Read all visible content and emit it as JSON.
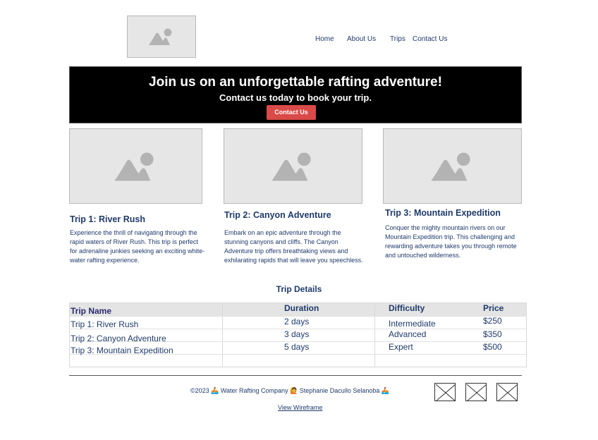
{
  "header": {
    "logo_icon": "image-placeholder-icon",
    "nav": [
      {
        "label": "Home"
      },
      {
        "label": "About Us"
      },
      {
        "label": "Trips"
      },
      {
        "label": "Contact Us"
      }
    ]
  },
  "hero": {
    "title": "Join us on an unforgettable rafting adventure!",
    "subtitle": "Contact us today to book your trip.",
    "button": "Contact Us",
    "button_color": "#d94a48"
  },
  "trips": [
    {
      "title": "Trip 1: River Rush",
      "desc": "Experience the thrill of navigating through the rapid waters of River Rush. This trip is perfect for adrenaline junkies seeking an exciting white-water rafting experience."
    },
    {
      "title": "Trip 2: Canyon Adventure",
      "desc": "Embark on an epic adventure through the stunning canyons and cliffs. The Canyon Adventure trip offers breathtaking views and exhilarating rapids that will leave you speechless."
    },
    {
      "title": "Trip 3: Mountain Expedition",
      "desc": "Conquer the mighty mountain rivers on our Mountain Expedition trip. This challenging and rewarding adventure takes you through remote and untouched wilderness."
    }
  ],
  "details": {
    "title": "Trip Details",
    "headers": [
      "Trip Name",
      "Duration",
      "Difficulty",
      "Price"
    ],
    "rows": [
      [
        "Trip 1: River Rush",
        "2 days",
        "Intermediate",
        "$250"
      ],
      [
        "Trip 2: Canyon Adventure",
        "3 days",
        "Advanced",
        "$350"
      ],
      [
        "Trip 3: Mountain Expedition",
        "5 days",
        "Expert",
        "$500"
      ]
    ]
  },
  "footer": {
    "text": "©2023 🚣 Water Rafting Company 🙋 Stephanie Dacullo Selanoba 🚣",
    "link": "View Wireframe",
    "social_icons": [
      "placeholder-x-icon",
      "placeholder-x-icon",
      "placeholder-x-icon"
    ]
  }
}
